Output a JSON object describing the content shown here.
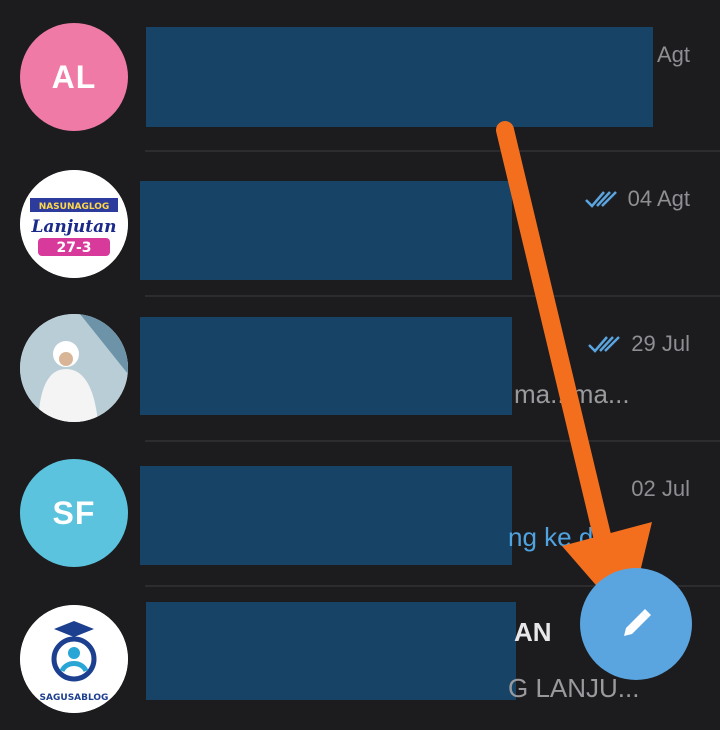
{
  "chats": [
    {
      "avatar_text": "AL",
      "avatar_color": "#ef7aa6",
      "date": "Agt",
      "snippet": "",
      "double_tick": false
    },
    {
      "avatar_logo_text": [
        "NASUNAGLOG",
        "Lanjutan",
        "27-3"
      ],
      "date": "04 Agt",
      "snippet": "",
      "double_tick": true
    },
    {
      "date": "29 Jul",
      "snippet": "ma...ma...",
      "double_tick": true
    },
    {
      "avatar_text": "SF",
      "avatar_color": "#5bc3dd",
      "date": "02 Jul",
      "snippet": "ng ke d",
      "double_tick": false
    },
    {
      "avatar_logo_text": [
        "SAGUSABLOG"
      ],
      "date": "",
      "title_fragment": "AN",
      "snippet": "G LANJU...",
      "double_tick": false
    }
  ],
  "colors": {
    "background": "#1c1c1e",
    "redaction": "#174366",
    "fab": "#5aa5e0",
    "arrow": "#f36f1e",
    "tick": "#5aa5e0"
  },
  "fab": {
    "icon": "pencil-icon"
  }
}
